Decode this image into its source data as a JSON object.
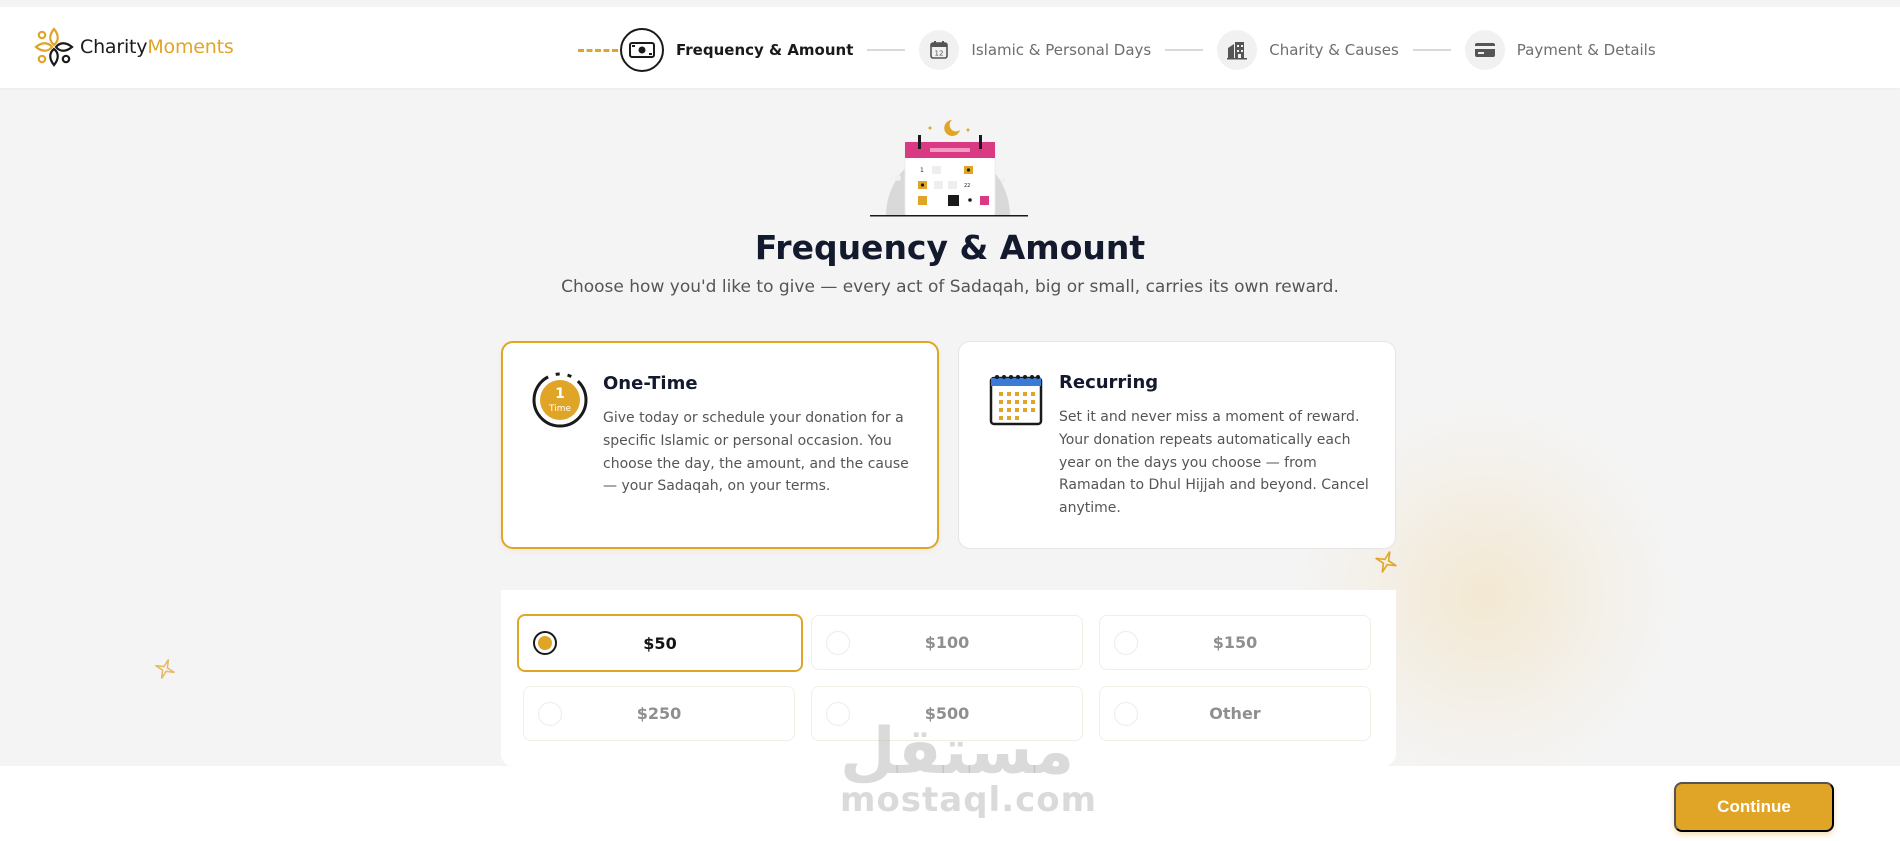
{
  "brand": {
    "name_part1": "Charity",
    "name_part2": "Moments",
    "accent_color": "#e0a526"
  },
  "stepper": {
    "steps": [
      {
        "label": "Frequency & Amount",
        "icon": "banknote-icon",
        "active": true
      },
      {
        "label": "Islamic & Personal Days",
        "icon": "calendar-icon",
        "active": false
      },
      {
        "label": "Charity & Causes",
        "icon": "building-icon",
        "active": false
      },
      {
        "label": "Payment & Details",
        "icon": "credit-card-icon",
        "active": false
      }
    ]
  },
  "page": {
    "title": "Frequency & Amount",
    "subtitle": "Choose how you'd like to give — every act of Sadaqah, big or small, carries its own reward."
  },
  "frequency_options": [
    {
      "title": "One-Time",
      "description": "Give today or schedule your donation for a specific Islamic or personal occasion. You choose the day, the amount, and the cause — your Sadaqah, on your terms.",
      "icon": "one-time-badge-icon",
      "icon_number": "1",
      "icon_text": "Time",
      "selected": true
    },
    {
      "title": "Recurring",
      "description": "Set it and never miss a moment of reward. Your donation repeats automatically each year on the days you choose — from Ramadan to Dhul Hijjah and beyond. Cancel anytime.",
      "icon": "recurring-calendar-icon",
      "selected": false
    }
  ],
  "amounts": [
    {
      "label": "$50",
      "selected": true
    },
    {
      "label": "$100",
      "selected": false
    },
    {
      "label": "$150",
      "selected": false
    },
    {
      "label": "$250",
      "selected": false
    },
    {
      "label": "$500",
      "selected": false
    },
    {
      "label": "Other",
      "selected": false
    }
  ],
  "footer": {
    "continue_label": "Continue"
  },
  "watermark": {
    "arabic": "مستقل",
    "latin": "mostaql.com"
  }
}
